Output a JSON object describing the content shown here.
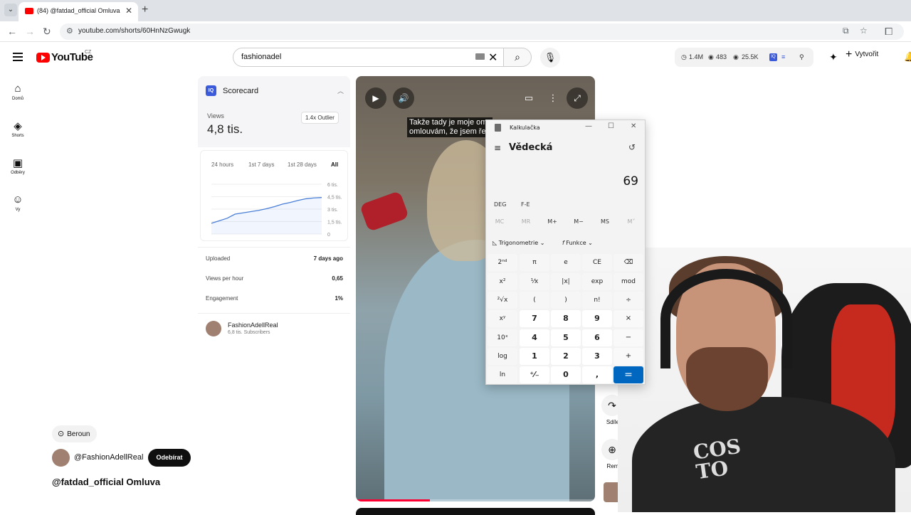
{
  "browser": {
    "tab_title": "(84) @fatdad_official Omluva -",
    "url": "youtube.com/shorts/60HnNzGwugk",
    "tab_close": "✕",
    "new_tab": "+"
  },
  "header": {
    "logo_text": "YouTube",
    "region": "CZ",
    "search_value": "fashionadel",
    "stats": {
      "views": "1.4M",
      "watching": "483",
      "other": "25.5K"
    },
    "create_label": "Vytvořit"
  },
  "sidebar": {
    "items": [
      {
        "label": "Domů",
        "icon": "home-icon"
      },
      {
        "label": "Shorts",
        "icon": "shorts-icon"
      },
      {
        "label": "Odběry",
        "icon": "subscriptions-icon"
      },
      {
        "label": "Vy",
        "icon": "you-icon"
      }
    ]
  },
  "scorecard": {
    "title": "Scorecard",
    "views_label": "Views",
    "views_value": "4,8 tis.",
    "outlier_badge": "1.4x Outlier",
    "tabs": [
      "24 hours",
      "1st 7 days",
      "1st 28 days",
      "All"
    ],
    "active_tab": "All",
    "y_ticks": [
      "6 tis.",
      "4,5 tis.",
      "3 tis.",
      "1,5 tis.",
      "0"
    ],
    "rows": [
      {
        "label": "Uploaded",
        "value": "7 days ago"
      },
      {
        "label": "Views per hour",
        "value": "0,65"
      },
      {
        "label": "Engagement",
        "value": "1%"
      }
    ],
    "channel_name": "FashionAdellReal",
    "channel_subs": "6,8 tis. Subscribers",
    "series": [
      1300,
      1600,
      1900,
      2400,
      2550,
      2700,
      2850,
      3050,
      3300,
      3600,
      3800,
      4050,
      4250,
      4350,
      4400
    ]
  },
  "video": {
    "subtitle": "Takže tady je moje om\nomlouvám, že jsem ře",
    "progress": 0.31
  },
  "calculator": {
    "window_title": "Kalkulačka",
    "mode": "Vědecká",
    "display": "69",
    "options": [
      "DEG",
      "F-E"
    ],
    "memory": [
      "MC",
      "MR",
      "M+",
      "M−",
      "MS",
      "M˅"
    ],
    "func_menus": [
      "Trigonometrie",
      "Funkce"
    ],
    "keys": [
      [
        "2ⁿᵈ",
        "π",
        "e",
        "CE",
        "⌫"
      ],
      [
        "x²",
        "¹⁄x",
        "|x|",
        "exp",
        "mod"
      ],
      [
        "²√x",
        "(",
        ")",
        "n!",
        "÷"
      ],
      [
        "xʸ",
        "7",
        "8",
        "9",
        "×"
      ],
      [
        "10ˣ",
        "4",
        "5",
        "6",
        "−"
      ],
      [
        "log",
        "1",
        "2",
        "3",
        "+"
      ],
      [
        "ln",
        "⁺⁄₋",
        "0",
        ",",
        "="
      ]
    ]
  },
  "side_actions": [
    {
      "label": "Sdíle",
      "icon": "share-icon"
    },
    {
      "label": "Rem",
      "icon": "remix-icon"
    }
  ],
  "webcam": {
    "shirt_text": "COS\nTO"
  },
  "video_info": {
    "location": "Beroun",
    "handle": "@FashionAdellReal",
    "subscribe": "Odebírat",
    "title": "@fatdad_official Omluva"
  }
}
